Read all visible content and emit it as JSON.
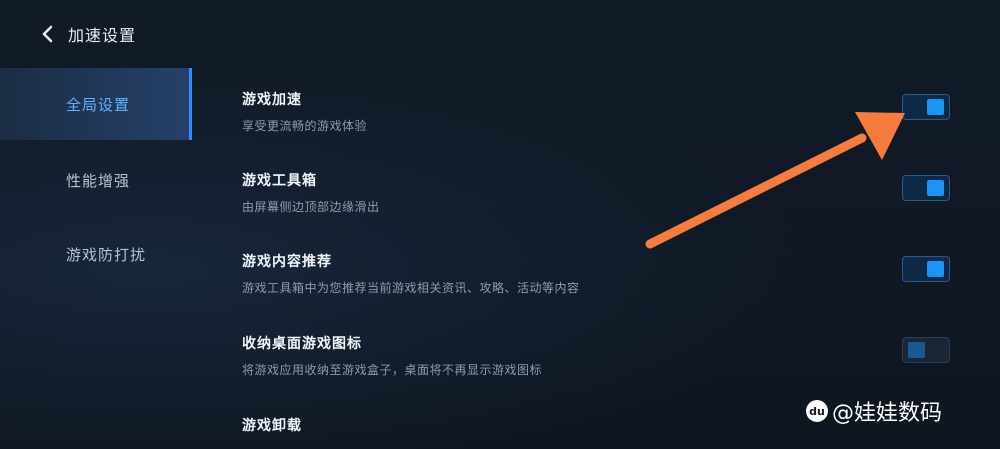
{
  "header": {
    "title": "加速设置"
  },
  "sidebar": {
    "items": [
      {
        "label": "全局设置",
        "active": true
      },
      {
        "label": "性能增强",
        "active": false
      },
      {
        "label": "游戏防打扰",
        "active": false
      }
    ]
  },
  "settings": [
    {
      "title": "游戏加速",
      "desc": "享受更流畅的游戏体验",
      "toggle": "on"
    },
    {
      "title": "游戏工具箱",
      "desc": "由屏幕侧边顶部边缘滑出",
      "toggle": "on"
    },
    {
      "title": "游戏内容推荐",
      "desc": "游戏工具箱中为您推荐当前游戏相关资讯、攻略、活动等内容",
      "toggle": "on"
    },
    {
      "title": "收纳桌面游戏图标",
      "desc": "将游戏应用收纳至游戏盒子，桌面将不再显示游戏图标",
      "toggle": "disabled-off"
    },
    {
      "title": "游戏卸载",
      "desc": ""
    }
  ],
  "annotation": {
    "color": "#f57c3c"
  },
  "watermark": {
    "text": "@娃娃数码",
    "logo": "du"
  },
  "colors": {
    "accent": "#1a95f5",
    "active_nav_text": "#5fb4ff",
    "background": "#0f1722"
  },
  "icons": {
    "back": "chevron-left-icon"
  }
}
